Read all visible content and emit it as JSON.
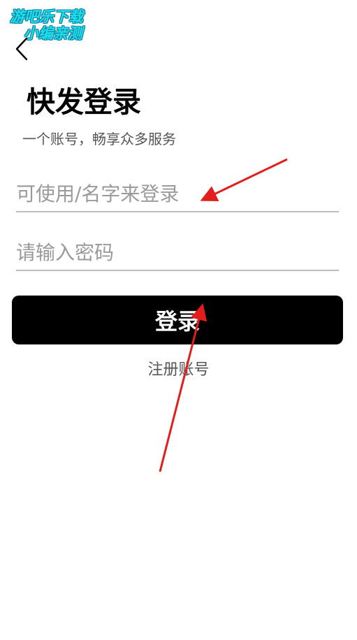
{
  "watermark": {
    "line1": "游吧乐下载",
    "line2": "小编亲测"
  },
  "header": {
    "back_icon": "chevron-left-icon"
  },
  "login": {
    "title": "快发登录",
    "subtitle": "一个账号，畅享众多服务",
    "username_placeholder": "可使用/名字来登录",
    "password_placeholder": "请输入密码",
    "login_button_label": "登录",
    "register_link_label": "注册账号"
  },
  "colors": {
    "annotation_arrow": "#e31c1c",
    "button_background": "#000000",
    "watermark_fill": "#1fe0e8"
  }
}
